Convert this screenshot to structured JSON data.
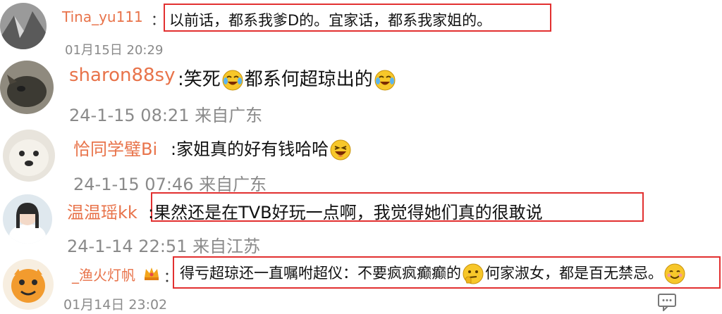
{
  "comments": [
    {
      "user": "Tina_yu111",
      "separator": "：",
      "text": "以前话，都系我爹D的。宜家话，都系我家姐的。",
      "time": "01月15日 20:29"
    },
    {
      "user": "sharon88sy",
      "separator": ":",
      "text_a": "笑死",
      "text_b": "都系何超琼出的",
      "emoji": "laugh-cry-emoji",
      "time": "24-1-15 08:21",
      "location": "来自广东"
    },
    {
      "user": "恰同学璧Bi",
      "separator": ":",
      "text": "家姐真的好有钱哈哈",
      "emoji": "laughing-emoji",
      "time": "24-1-15 07:46",
      "location": "来自广东"
    },
    {
      "user": "温温瑶kk",
      "separator": ":",
      "text": "果然还是在TVB好玩一点啊，我觉得她们真的很敢说",
      "time": "24-1-14 22:51",
      "location": "来自江苏"
    },
    {
      "user": "_渔火灯帆",
      "separator": "：",
      "text_a": "得亏超琼还一直嘱咐超仪：不要疯疯癫癫的",
      "text_b": "何家淑女，都是百无禁忌。",
      "emoji_a": "thinking-emoji",
      "emoji_b": "smile-emoji",
      "time": "01月14日 23:02"
    }
  ],
  "colors": {
    "username": "#e8734a",
    "highlight_border": "#e23030",
    "meta": "#8a8a8a"
  }
}
